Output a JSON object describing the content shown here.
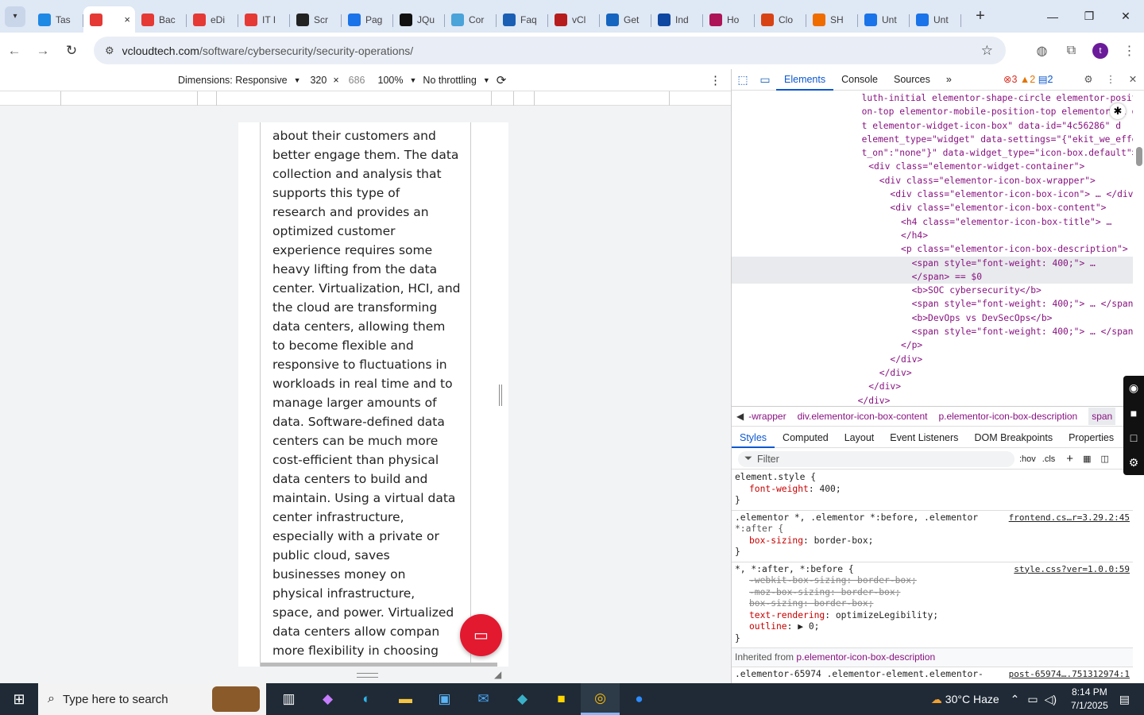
{
  "browser": {
    "tabs": [
      {
        "label": "Tas",
        "icon": "tasks-favicon",
        "color": "#1e88e5"
      },
      {
        "label": "",
        "icon": "vcloudtech-favicon",
        "color": "#e53935",
        "active": true
      },
      {
        "label": "Bac",
        "icon": "vcloudtech-favicon",
        "color": "#e53935"
      },
      {
        "label": "eDi",
        "icon": "vcloudtech-favicon",
        "color": "#e53935"
      },
      {
        "label": "IT I",
        "icon": "vcloudtech-favicon",
        "color": "#e53935"
      },
      {
        "label": "Scr",
        "icon": "github-favicon",
        "color": "#222222"
      },
      {
        "label": "Pag",
        "icon": "pagespeed-favicon",
        "color": "#1a73e8"
      },
      {
        "label": "JQu",
        "icon": "jquery-favicon",
        "color": "#111111"
      },
      {
        "label": "Cor",
        "icon": "ai-favicon",
        "color": "#4aa3d9"
      },
      {
        "label": "Faq",
        "icon": "scales-favicon",
        "color": "#1a5fb4"
      },
      {
        "label": "vCl",
        "icon": "v-favicon",
        "color": "#b71c1c"
      },
      {
        "label": "Get",
        "icon": "x-favicon",
        "color": "#1565c0"
      },
      {
        "label": "Ind",
        "icon": "check-favicon",
        "color": "#0d47a1"
      },
      {
        "label": "Ho",
        "icon": "flower-favicon",
        "color": "#ad1457"
      },
      {
        "label": "Clo",
        "icon": "claude-favicon",
        "color": "#d84315"
      },
      {
        "label": "SH",
        "icon": "circle-favicon",
        "color": "#ef6c00"
      },
      {
        "label": "Unt",
        "icon": "docs-favicon",
        "color": "#1a73e8"
      },
      {
        "label": "Unt",
        "icon": "docs-favicon",
        "color": "#1a73e8"
      }
    ],
    "tab_close": "×",
    "new_tab": "+",
    "url_host": "vcloudtech.com",
    "url_path": "/software/cybersecurity/security-operations/",
    "avatar": "t"
  },
  "device_toolbar": {
    "dimensions_label": "Dimensions: Responsive",
    "width": "320",
    "times": "×",
    "height": "686",
    "zoom": "100%",
    "throttling": "No throttling"
  },
  "article_lines": [
    "about their customers and",
    "better engage them. The data",
    "collection and analysis that",
    "supports this type of",
    "research and provides an",
    "optimized customer",
    "experience requires some",
    "heavy lifting from the data",
    "center. Virtualization, HCI, and",
    "the cloud are transforming",
    "data centers, allowing them",
    "to become flexible and",
    "responsive to fluctuations in",
    "workloads in real time and to",
    "manage larger amounts of",
    "data. Software-defined data",
    "centers can be much more",
    "cost-efficient than physical",
    "data centers to build and",
    "maintain. Using a virtual data",
    "center infrastructure,",
    "especially with a private or",
    "public cloud, saves",
    "businesses money on",
    "physical infrastructure,",
    "space, and power. Virtualized",
    "data centers allow compan",
    "more flexibility in choosing"
  ],
  "devtools": {
    "tabs": [
      "Elements",
      "Console",
      "Sources"
    ],
    "errors": "3",
    "warnings": "2",
    "messages": "2",
    "dom_lines": [
      "  luth-initial elementor-shape-circle elementor-positi",
      "  on-top elementor-mobile-position-top elementor-wi ge",
      "  t elementor-widget-icon-box\" data-id=\"4c56286\" d",
      "  element_type=\"widget\" data-settings=\"{\"ekit_we_effec",
      "  t_on\":\"none\"}\" data-widget_type=\"icon-box.default\">",
      "    <div class=\"elementor-widget-container\">",
      "      <div class=\"elementor-icon-box-wrapper\">",
      "        <div class=\"elementor-icon-box-icon\"> … </div>",
      "        <div class=\"elementor-icon-box-content\">",
      "          <h4 class=\"elementor-icon-box-title\"> … ",
      "          </h4>",
      "          <p class=\"elementor-icon-box-description\">",
      "            <span style=\"font-weight: 400;\"> … ",
      "            </span> == $0",
      "            <b>SOC cybersecurity</b>",
      "            <span style=\"font-weight: 400;\"> … </span>",
      "            <b>DevOps vs DevSecOps</b>",
      "            <span style=\"font-weight: 400;\"> … </span>",
      "          </p>",
      "        </div>",
      "      </div>",
      "    </div>",
      "  </div>",
      "  </div>"
    ],
    "breadcrumbs": [
      "-wrapper",
      "div.elementor-icon-box-content",
      "p.elementor-icon-box-description",
      "span"
    ],
    "subtabs": [
      "Styles",
      "Computed",
      "Layout",
      "Event Listeners",
      "DOM Breakpoints",
      "Properties"
    ],
    "filter_placeholder": "Filter",
    "hov": ":hov",
    "cls": ".cls",
    "styles": {
      "r1_selector": "element.style {",
      "r1_prop": "font-weight",
      "r1_val": "400;",
      "r2_selector": ".elementor *, .elementor *:before, .elementor",
      "r2_selector2": "*:after {",
      "r2_src": "frontend.cs…r=3.29.2:45",
      "r2_prop": "box-sizing",
      "r2_val": "border-box;",
      "r3_selector": "*, *:after, *:before {",
      "r3_src": "style.css?ver=1.0.0:59",
      "r3_p1": "-webkit-box-sizing: border-box;",
      "r3_p2": "-moz-box-sizing: border-box;",
      "r3_p3": "box-sizing: border-box;",
      "r3_p4n": "text-rendering",
      "r3_p4v": "optimizeLegibility;",
      "r3_p5n": "outline",
      "r3_p5v": "▶ 0;",
      "close": "}",
      "inherited_label": "Inherited from",
      "inherited_el": "p.elementor-icon-box-description",
      "r4_selector": ".elementor-65974 .elementor-element.elementor-",
      "r4_src": "post-65974….751312974:1"
    }
  },
  "taskbar": {
    "search_placeholder": "Type here to search",
    "weather": "30°C  Haze",
    "time": "8:14 PM",
    "date": "7/1/2025"
  }
}
